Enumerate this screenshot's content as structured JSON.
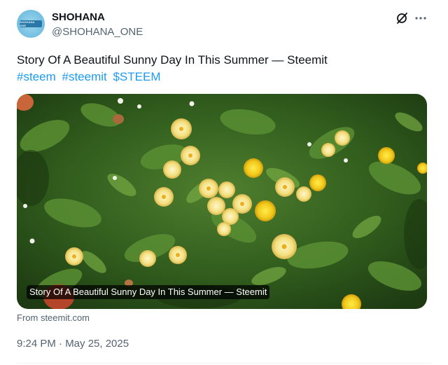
{
  "author": {
    "name": "SHOHANA",
    "handle": "@SHOHANA_ONE",
    "avatar_logo_text": "SHOHANA ONE"
  },
  "actions": {
    "grok_icon": "grok-icon",
    "more_icon": "more-icon"
  },
  "post": {
    "text": "Story Of A Beautiful Sunny Day In This Summer — Steemit",
    "tags": [
      "#steem",
      "#steemit",
      "$STEEM"
    ]
  },
  "card": {
    "caption": "Story Of A Beautiful Sunny Day In This Summer — Steemit",
    "source": "From steemit.com"
  },
  "meta": {
    "timestamp": "9:24 PM · May 25, 2025"
  },
  "colors": {
    "link": "#1d9bf0",
    "secondary_text": "#536471",
    "primary_text": "#0f1419"
  }
}
